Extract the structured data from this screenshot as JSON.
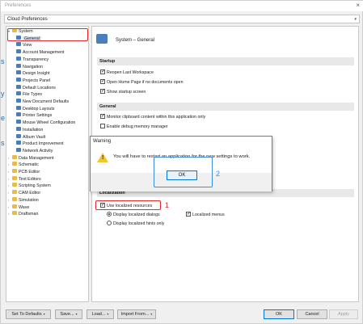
{
  "window": {
    "title": "Preferences",
    "close_glyph": "×"
  },
  "profile": {
    "value": "Cloud Preferences",
    "arrow": "▾"
  },
  "left_edge_text": [
    "s",
    "y",
    "e",
    "s"
  ],
  "tree": [
    {
      "label": "System",
      "toggle": "▾",
      "icon": "folder-icon"
    },
    {
      "label": "General",
      "icon": "gear-icon",
      "selected": true
    },
    {
      "label": "View",
      "icon": "gear-icon"
    },
    {
      "label": "Account Management",
      "icon": "gear-icon"
    },
    {
      "label": "Transparency",
      "icon": "gear-icon"
    },
    {
      "label": "Navigation",
      "icon": "gear-icon"
    },
    {
      "label": "Design Insight",
      "icon": "gear-icon"
    },
    {
      "label": "Projects Panel",
      "icon": "gear-icon"
    },
    {
      "label": "Default Locations",
      "icon": "gear-icon"
    },
    {
      "label": "File Types",
      "icon": "gear-icon"
    },
    {
      "label": "New Document Defaults",
      "icon": "gear-icon"
    },
    {
      "label": "Desktop Layouts",
      "icon": "gear-icon"
    },
    {
      "label": "Printer Settings",
      "icon": "gear-icon"
    },
    {
      "label": "Mouse Wheel Configuration",
      "icon": "gear-icon"
    },
    {
      "label": "Installation",
      "icon": "gear-icon"
    },
    {
      "label": "Album Vault",
      "icon": "gear-icon"
    },
    {
      "label": "Product Improvement",
      "icon": "gear-icon"
    },
    {
      "label": "Network Activity",
      "icon": "gear-icon"
    },
    {
      "label": "Data Management",
      "toggle": "›",
      "icon": "folder-icon"
    },
    {
      "label": "Schematic",
      "toggle": "›",
      "icon": "folder-icon"
    },
    {
      "label": "PCB Editor",
      "toggle": "›",
      "icon": "folder-icon"
    },
    {
      "label": "Text Editors",
      "toggle": "›",
      "icon": "folder-icon"
    },
    {
      "label": "Scripting System",
      "toggle": "›",
      "icon": "folder-icon"
    },
    {
      "label": "CAM Editor",
      "toggle": "›",
      "icon": "folder-icon"
    },
    {
      "label": "Simulation",
      "toggle": "›",
      "icon": "folder-icon"
    },
    {
      "label": "Wave",
      "toggle": "›",
      "icon": "folder-icon"
    },
    {
      "label": "Draftsman",
      "toggle": "›",
      "icon": "folder-icon"
    }
  ],
  "panel": {
    "title": "System – General",
    "startup": {
      "heading": "Startup",
      "options": [
        {
          "label": "Reopen Last Workspace",
          "checked": true
        },
        {
          "label": "Open Home Page if no documents open",
          "checked": true
        },
        {
          "label": "Show startup screen",
          "checked": true
        }
      ]
    },
    "general": {
      "heading": "General",
      "options": [
        {
          "label": "Monitor clipboard content within this application only",
          "checked": true
        },
        {
          "label": "Enable debug memory manager",
          "checked": false
        }
      ]
    },
    "localization": {
      "heading": "Localization",
      "use_localized": {
        "label": "Use localized resources",
        "checked": true
      },
      "radios": [
        {
          "label": "Display localized dialogs",
          "selected": true
        },
        {
          "label": "Display localized hints only",
          "selected": false
        }
      ],
      "localized_menus": {
        "label": "Localized menus",
        "checked": true
      }
    }
  },
  "dialog": {
    "title": "Warning",
    "message": "You will have to restart an application for the new settings to work.",
    "ok_label": "OK",
    "warning_glyph": "!"
  },
  "annotations": {
    "one": "1",
    "two": "2",
    "red": "#e02a2a",
    "blue": "#3b8de0"
  },
  "footer": {
    "set_defaults": "Set To Defaults",
    "save": "Save...",
    "load": "Load...",
    "import_from": "Import From...",
    "ok": "OK",
    "cancel": "Cancel",
    "apply": "Apply",
    "dropdown_glyph": "▾"
  },
  "check_glyph": "✓"
}
